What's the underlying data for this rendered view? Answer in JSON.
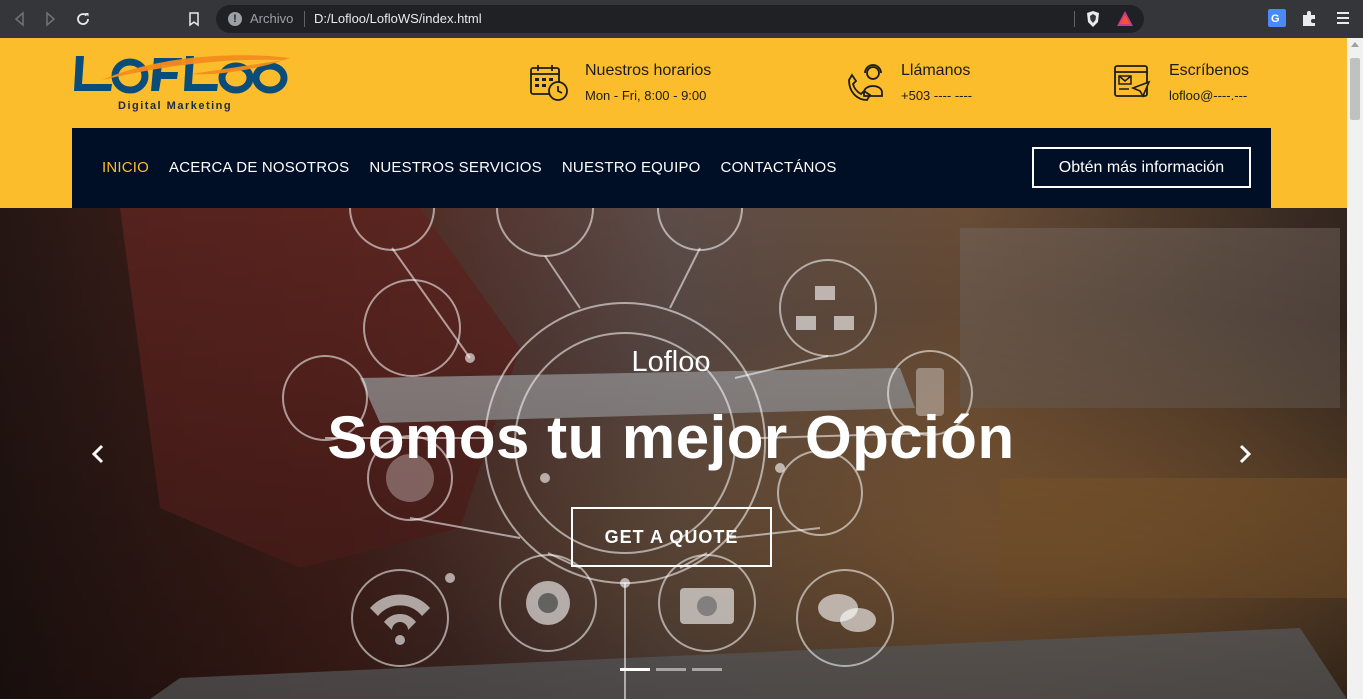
{
  "browser": {
    "archivo_label": "Archivo",
    "url": "D:/Lofloo/LofloWS/index.html"
  },
  "header": {
    "logo_text": "LOFLOO",
    "logo_subtitle": "Digital Marketing",
    "hours": {
      "title": "Nuestros horarios",
      "value": "Mon - Fri, 8:00 - 9:00"
    },
    "phone": {
      "title": "Llámanos",
      "value": "+503 ---- ----"
    },
    "email": {
      "title": "Escríbenos",
      "value": "lofloo@----.---"
    }
  },
  "navbar": {
    "items": [
      {
        "label": "INICIO",
        "active": true
      },
      {
        "label": "ACERCA DE NOSOTROS",
        "active": false
      },
      {
        "label": "NUESTROS SERVICIOS",
        "active": false
      },
      {
        "label": "NUESTRO EQUIPO",
        "active": false
      },
      {
        "label": "CONTACTÁNOS",
        "active": false
      }
    ],
    "cta_label": "Obtén más información"
  },
  "hero": {
    "eyebrow": "Lofloo",
    "title": "Somos tu mejor Opción",
    "button_label": "GET A QUOTE",
    "slides": 3,
    "active_slide": 1
  },
  "colors": {
    "accent": "#fbbd2c",
    "navbar_bg": "#010f26",
    "logo_blue": "#0b4d7a",
    "logo_orange": "#f28c1c"
  }
}
